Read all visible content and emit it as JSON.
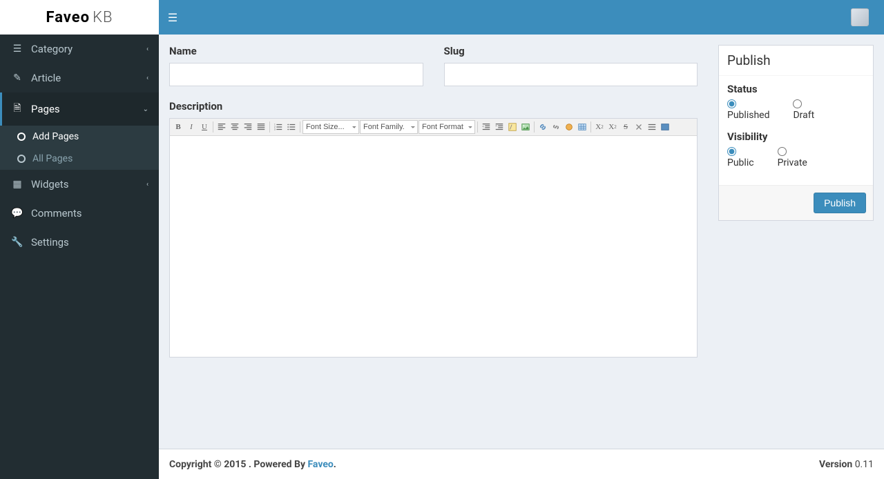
{
  "logo": {
    "brand": "Faveo",
    "suffix": "KB"
  },
  "sidebar": {
    "items": [
      {
        "label": "Category",
        "icon": "list"
      },
      {
        "label": "Article",
        "icon": "edit"
      },
      {
        "label": "Pages",
        "icon": "file"
      },
      {
        "label": "Widgets",
        "icon": "grid"
      },
      {
        "label": "Comments",
        "icon": "chat"
      },
      {
        "label": "Settings",
        "icon": "wrench"
      }
    ],
    "pages_sub": [
      {
        "label": "Add Pages"
      },
      {
        "label": "All Pages"
      }
    ]
  },
  "form": {
    "name_label": "Name",
    "name_value": "",
    "slug_label": "Slug",
    "slug_value": "",
    "desc_label": "Description",
    "toolbar": {
      "font_size": "Font Size...",
      "font_family": "Font Family.",
      "font_format": "Font Format"
    }
  },
  "publish": {
    "title": "Publish",
    "status_label": "Status",
    "status_published": "Published",
    "status_draft": "Draft",
    "visibility_label": "Visibility",
    "vis_public": "Public",
    "vis_private": "Private",
    "button": "Publish"
  },
  "footer": {
    "copyright_prefix": "Copyright © 2015 . Powered By ",
    "brand": "Faveo",
    "suffix": ".",
    "version_label": "Version",
    "version": " 0.11"
  }
}
